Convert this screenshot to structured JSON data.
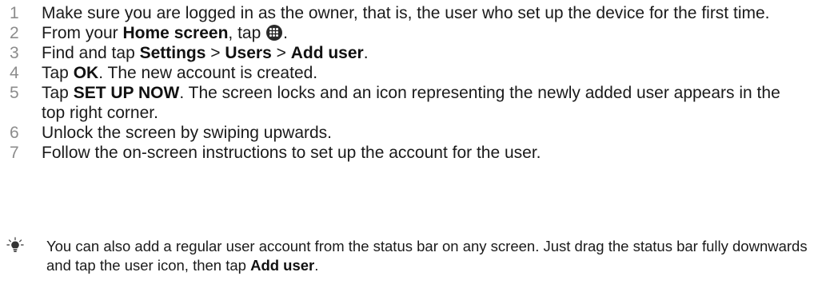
{
  "steps": [
    {
      "num": "1",
      "parts": [
        {
          "t": "Make sure you are logged in as the owner, that is, the user who set up the device for the first time."
        }
      ]
    },
    {
      "num": "2",
      "parts": [
        {
          "t": "From your "
        },
        {
          "t": "Home screen",
          "b": true
        },
        {
          "t": ", tap "
        },
        {
          "icon": "apps-grid-icon"
        },
        {
          "t": "."
        }
      ]
    },
    {
      "num": "3",
      "parts": [
        {
          "t": "Find and tap "
        },
        {
          "t": "Settings",
          "b": true
        },
        {
          "t": " > "
        },
        {
          "t": "Users",
          "b": true
        },
        {
          "t": " > "
        },
        {
          "t": "Add user",
          "b": true
        },
        {
          "t": "."
        }
      ]
    },
    {
      "num": "4",
      "parts": [
        {
          "t": "Tap "
        },
        {
          "t": "OK",
          "b": true
        },
        {
          "t": ". The new account is created."
        }
      ]
    },
    {
      "num": "5",
      "parts": [
        {
          "t": "Tap "
        },
        {
          "t": "SET UP NOW",
          "b": true
        },
        {
          "t": ". The screen locks and an icon representing the newly added user appears in the top right corner."
        }
      ]
    },
    {
      "num": "6",
      "parts": [
        {
          "t": "Unlock the screen by swiping upwards."
        }
      ]
    },
    {
      "num": "7",
      "parts": [
        {
          "t": "Follow the on-screen instructions to set up the account for the user."
        }
      ]
    }
  ],
  "tip": {
    "icon": "lightbulb-tip-icon",
    "parts": [
      {
        "t": "You can also add a regular user account from the status bar on any screen. Just drag the status bar fully downwards and tap the user icon, then tap "
      },
      {
        "t": "Add user",
        "b": true
      },
      {
        "t": "."
      }
    ]
  },
  "colors": {
    "text": "#1a1a1a",
    "step_number": "#8c8c8c",
    "icon": "#2a2a2a"
  }
}
